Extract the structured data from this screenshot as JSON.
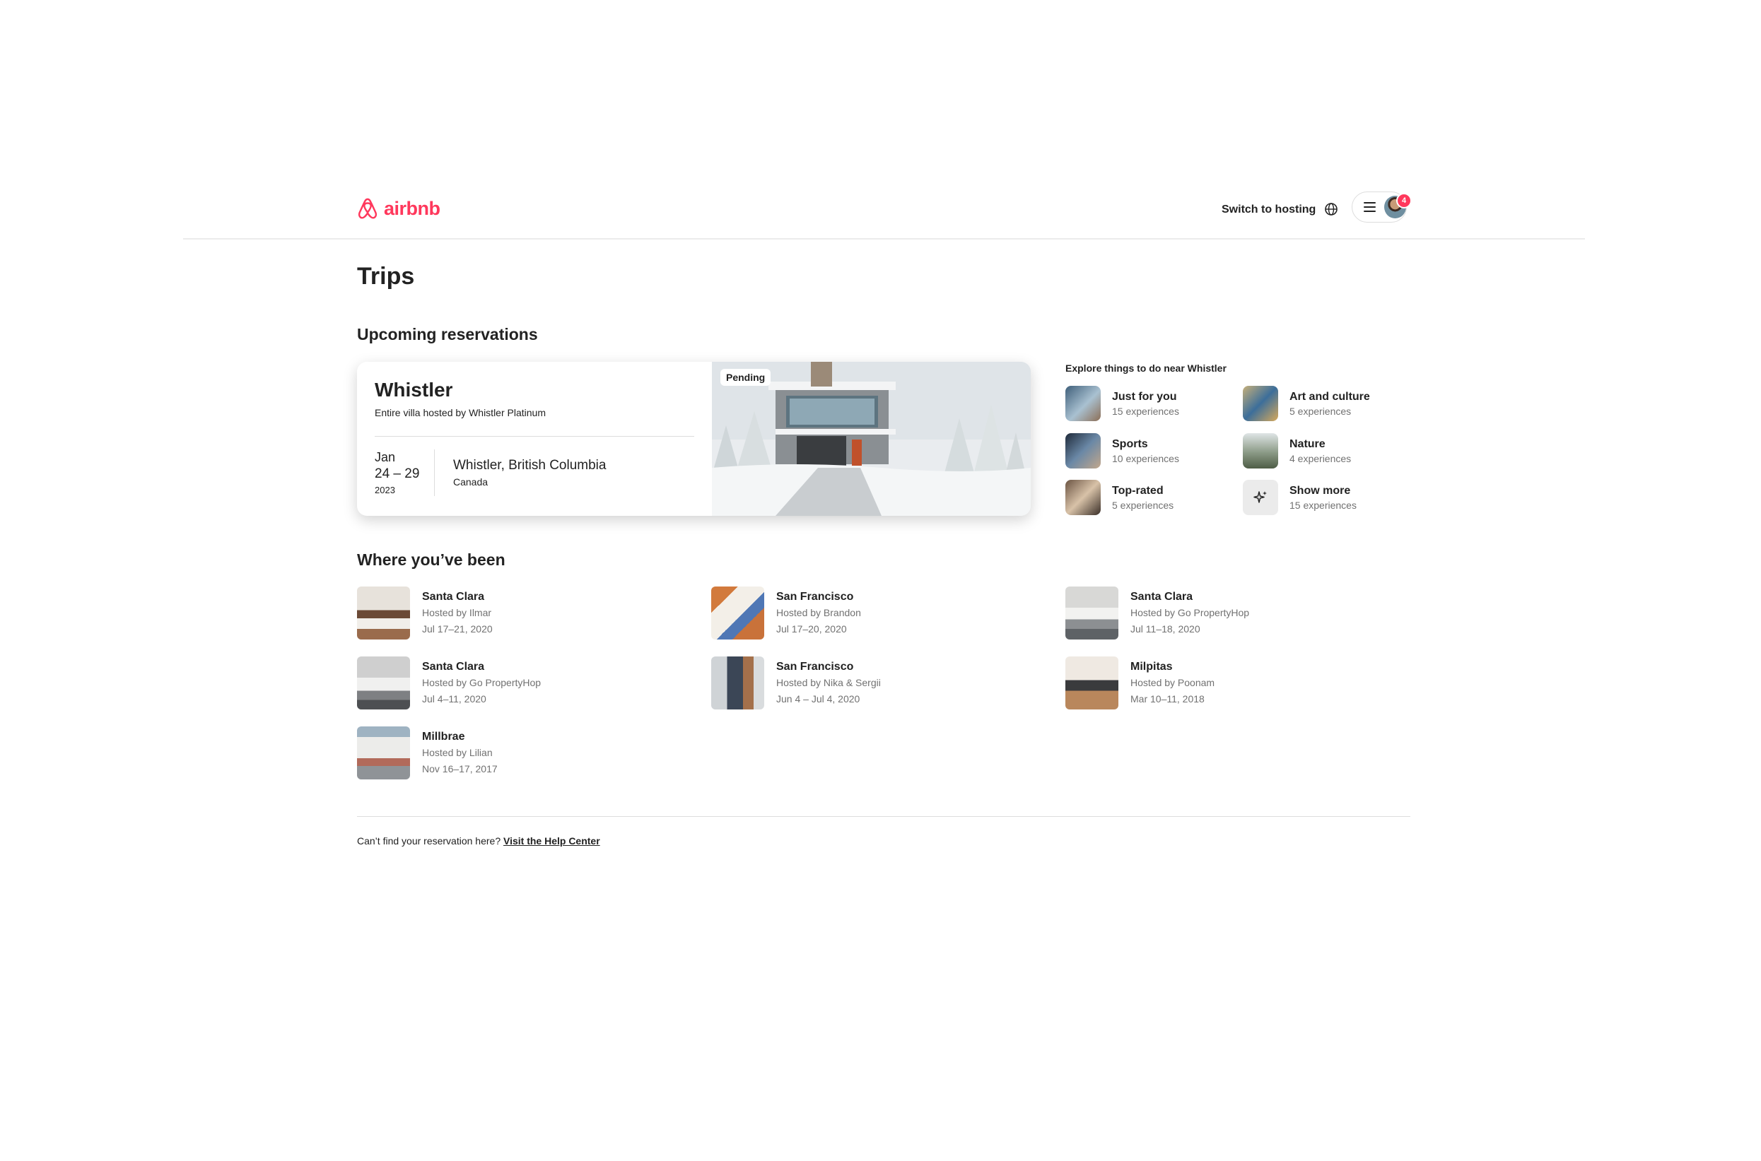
{
  "header": {
    "brand": "airbnb",
    "switch_label": "Switch to hosting",
    "notification_count": "4",
    "brand_color": "#FF385C"
  },
  "page_title": "Trips",
  "upcoming": {
    "section_title": "Upcoming reservations",
    "reservation": {
      "city": "Whistler",
      "subtitle": "Entire villa hosted by Whistler Platinum",
      "month": "Jan",
      "days": "24 – 29",
      "year": "2023",
      "location": "Whistler, British Columbia",
      "country": "Canada",
      "status": "Pending"
    },
    "explore": {
      "title": "Explore things to do near Whistler",
      "items": [
        {
          "name": "Just for you",
          "count": "15 experiences",
          "icon": "photo-thumbnail"
        },
        {
          "name": "Art and culture",
          "count": "5 experiences",
          "icon": "photo-thumbnail"
        },
        {
          "name": "Sports",
          "count": "10 experiences",
          "icon": "photo-thumbnail"
        },
        {
          "name": "Nature",
          "count": "4 experiences",
          "icon": "photo-thumbnail"
        },
        {
          "name": "Top-rated",
          "count": "5 experiences",
          "icon": "photo-thumbnail"
        },
        {
          "name": "Show more",
          "count": "15 experiences",
          "icon": "sparkle-icon"
        }
      ]
    }
  },
  "past": {
    "section_title": "Where you’ve been",
    "trips": [
      {
        "city": "Santa Clara",
        "host": "Hosted by Ilmar",
        "dates": "Jul 17–21, 2020"
      },
      {
        "city": "San Francisco",
        "host": "Hosted by Brandon",
        "dates": "Jul 17–20, 2020"
      },
      {
        "city": "Santa Clara",
        "host": "Hosted by Go PropertyHop",
        "dates": "Jul 11–18, 2020"
      },
      {
        "city": "Santa Clara",
        "host": "Hosted by Go PropertyHop",
        "dates": "Jul 4–11, 2020"
      },
      {
        "city": "San Francisco",
        "host": "Hosted by Nika & Sergii",
        "dates": "Jun 4 – Jul 4, 2020"
      },
      {
        "city": "Milpitas",
        "host": "Hosted by Poonam",
        "dates": "Mar 10–11, 2018"
      },
      {
        "city": "Millbrae",
        "host": "Hosted by Lilian",
        "dates": "Nov 16–17, 2017"
      }
    ]
  },
  "footer": {
    "text": "Can’t find your reservation here?",
    "link": "Visit the Help Center"
  }
}
